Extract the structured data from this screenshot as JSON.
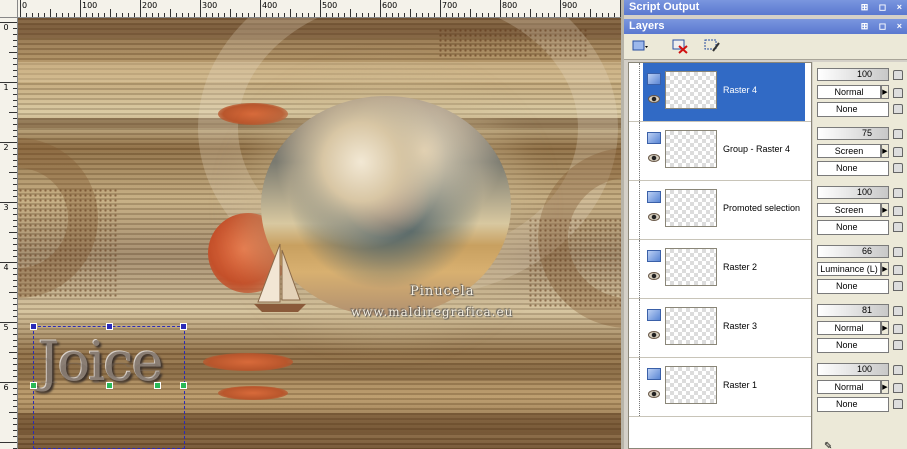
{
  "ruler": {
    "top_labels": [
      "0",
      "100",
      "200",
      "300",
      "400",
      "500",
      "600",
      "700",
      "800",
      "900"
    ],
    "left_labels": [
      "0",
      "1",
      "2",
      "3",
      "4",
      "5",
      "6"
    ]
  },
  "canvas": {
    "watermark_line1": "Pinucela",
    "watermark_line2": "www.maldiregrafica.eu",
    "text_layer": "Joice"
  },
  "panels": {
    "script_output_title": "Script Output",
    "layers_title": "Layers",
    "title_buttons": "⊞ ◻ ×"
  },
  "layers": [
    {
      "name": "Raster 4",
      "opacity": "100",
      "blend": "Normal",
      "mask": "None",
      "selected": true
    },
    {
      "name": "Group - Raster 4",
      "opacity": "75",
      "blend": "Screen",
      "mask": "None",
      "selected": false
    },
    {
      "name": "Promoted selection",
      "opacity": "100",
      "blend": "Screen",
      "mask": "None",
      "selected": false
    },
    {
      "name": "Raster 2",
      "opacity": "66",
      "blend": "Luminance (L)",
      "mask": "None",
      "selected": false
    },
    {
      "name": "Raster 3",
      "opacity": "81",
      "blend": "Normal",
      "mask": "None",
      "selected": false
    },
    {
      "name": "Raster 1",
      "opacity": "100",
      "blend": "Normal",
      "mask": "None",
      "selected": false
    }
  ],
  "icons": {
    "accent": "#316ac5",
    "title_bar": "#5a78d0"
  }
}
